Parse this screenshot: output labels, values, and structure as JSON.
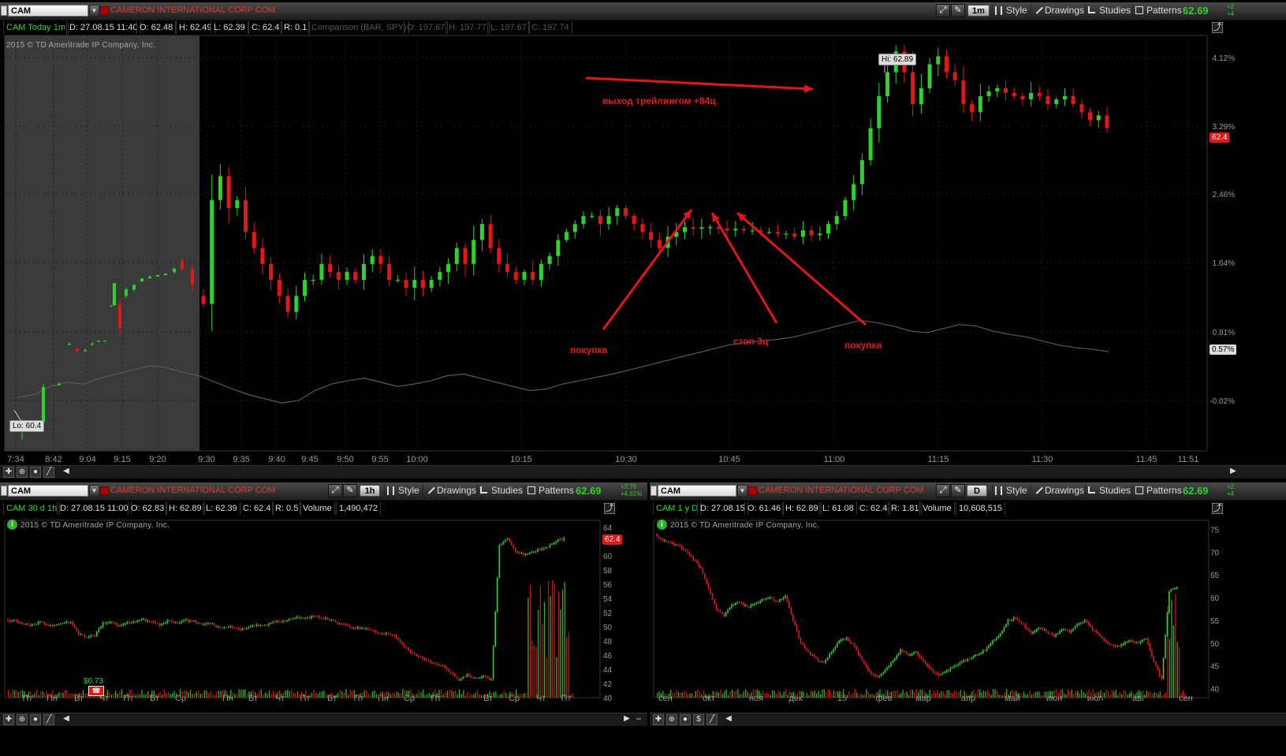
{
  "colors": {
    "up": "#2bd32b",
    "down": "#e51616",
    "compare": "#5a5a5a",
    "name": "#e03a2a",
    "grid": "#1c1c1c"
  },
  "main": {
    "symbol": "CAM",
    "company": "CAMERON INTERNATIONAL CORP COM",
    "timeframe": "1m",
    "buttons": {
      "style": "Style",
      "drawings": "Drawings",
      "studies": "Studies",
      "patterns": "Patterns"
    },
    "last": "62.69",
    "change_top": "+2",
    "change_bottom": "+4",
    "info": {
      "name": "CAM Today 1m",
      "d": "D: 27.08.15 11:40",
      "o": "O: 62.48",
      "h": "H: 62.49",
      "l": "L: 62.39",
      "c": "C: 62.4",
      "r": "R: 0.1"
    },
    "comparison": {
      "label": "Comparison (BAR, SPY)",
      "o": "O: 197.67",
      "h": "H: 197.77",
      "l": "L: 197.67",
      "c": "C: 197.74"
    },
    "copyright": "2015 © TD Ameritrade IP Company, Inc.",
    "hi_label": "Hi: 62.89",
    "lo_label": "Lo: 60.4",
    "price_tag": "62.4",
    "compare_tag": "0.57%",
    "annotations": {
      "exit": "выход трейлингом +84ц",
      "buy1": "покупка",
      "stop": "стоп 3ц",
      "buy2": "покупка"
    }
  },
  "left": {
    "symbol": "CAM",
    "company": "CAMERON INTERNATIONAL CORP COM",
    "timeframe": "1h",
    "buttons": {
      "style": "Style",
      "drawings": "Drawings",
      "studies": "Studies",
      "patterns": "Patterns"
    },
    "last": "62.69",
    "change_top": "+2.76",
    "change_bottom": "+4.61%",
    "info": {
      "name": "CAM 30 d 1h",
      "d": "D: 27.08.15 11:00",
      "o": "O: 62.83",
      "h": "H: 62.89",
      "l": "L: 62.39",
      "c": "C: 62.4",
      "r": "R: 0.5",
      "vol_label": "Volume",
      "vol": "1,490,472"
    },
    "copyright": "2015 © TD Ameritrade IP Company, Inc.",
    "price_tag": "62.4",
    "dividend": "$0.73"
  },
  "right": {
    "symbol": "CAM",
    "company": "CAMERON INTERNATIONAL CORP COM",
    "timeframe": "D",
    "buttons": {
      "style": "Style",
      "drawings": "Drawings",
      "studies": "Studies",
      "patterns": "Patterns"
    },
    "last": "62.69",
    "change_top": "+2",
    "change_bottom": "+4",
    "info": {
      "name": "CAM 1 y D",
      "d": "D: 27.08.15",
      "o": "O: 61.46",
      "h": "H: 62.89",
      "l": "L: 61.08",
      "c": "C: 62.4",
      "r": "R: 1.81",
      "vol_label": "Volume",
      "vol": "10,608,515"
    },
    "copyright": "2015 © TD Ameritrade IP Company, Inc."
  },
  "chart_data": [
    {
      "id": "main",
      "type": "candlestick",
      "title": "CAM Today 1m",
      "y_right_percent_ticks": [
        "4.12%",
        "3.29%",
        "2.46%",
        "1.64%",
        "0.81%",
        "-0.02%"
      ],
      "x_ticks": [
        "7:34",
        "8:42",
        "9:04",
        "9:15",
        "9:20",
        "9:30",
        "9:35",
        "9:40",
        "9:45",
        "9:50",
        "9:55",
        "10:00",
        "10:15",
        "10:30",
        "10:45",
        "11:00",
        "11:15",
        "11:30",
        "11:45",
        "11:51"
      ],
      "ylim": [
        60.38,
        62.98
      ],
      "high": 62.89,
      "low": 60.4,
      "last": 62.4,
      "premarket": [
        {
          "t": "7:34",
          "o": 60.52,
          "h": 60.58,
          "l": 60.45,
          "c": 60.56
        },
        {
          "t": "7:38",
          "o": 60.56,
          "h": 60.8,
          "l": 60.56,
          "c": 60.78
        },
        {
          "t": "8:42",
          "o": 60.79,
          "h": 60.81,
          "l": 60.79,
          "c": 60.8
        },
        {
          "t": "8:46",
          "o": 61.05,
          "h": 61.06,
          "l": 61.04,
          "c": 61.05
        },
        {
          "t": "8:50",
          "o": 61.02,
          "h": 61.02,
          "l": 61.0,
          "c": 61.0
        },
        {
          "t": "8:53",
          "o": 61.01,
          "h": 61.02,
          "l": 61.0,
          "c": 61.01
        },
        {
          "t": "8:57",
          "o": 61.05,
          "h": 61.06,
          "l": 61.04,
          "c": 61.05
        },
        {
          "t": "9:00",
          "o": 61.07,
          "h": 61.07,
          "l": 61.06,
          "c": 61.07
        },
        {
          "t": "9:04",
          "o": 61.07,
          "h": 61.07,
          "l": 61.07,
          "c": 61.07
        },
        {
          "t": "9:07",
          "o": 61.29,
          "h": 61.29,
          "l": 61.28,
          "c": 61.29
        },
        {
          "t": "9:11",
          "o": 61.29,
          "h": 61.43,
          "l": 61.29,
          "c": 61.43
        },
        {
          "t": "9:15",
          "o": 61.3,
          "h": 61.32,
          "l": 61.1,
          "c": 61.15
        },
        {
          "t": "9:17",
          "o": 61.35,
          "h": 61.4,
          "l": 61.34,
          "c": 61.39
        },
        {
          "t": "9:18",
          "o": 61.39,
          "h": 61.42,
          "l": 61.38,
          "c": 61.42
        },
        {
          "t": "9:19",
          "o": 61.44,
          "h": 61.46,
          "l": 61.44,
          "c": 61.46
        },
        {
          "t": "9:20",
          "o": 61.46,
          "h": 61.48,
          "l": 61.46,
          "c": 61.47
        },
        {
          "t": "9:22",
          "o": 61.47,
          "h": 61.48,
          "l": 61.47,
          "c": 61.48
        },
        {
          "t": "9:24",
          "o": 61.48,
          "h": 61.49,
          "l": 61.48,
          "c": 61.49
        },
        {
          "t": "9:26",
          "o": 61.5,
          "h": 61.53,
          "l": 61.49,
          "c": 61.52
        },
        {
          "t": "9:27",
          "o": 61.57,
          "h": 61.58,
          "l": 61.5,
          "c": 61.52
        },
        {
          "t": "9:28",
          "o": 61.52,
          "h": 61.55,
          "l": 61.38,
          "c": 61.42
        }
      ],
      "regular_close_path": [
        61.3,
        61.95,
        62.1,
        61.9,
        61.95,
        61.75,
        61.65,
        61.55,
        61.45,
        61.35,
        61.25,
        61.35,
        61.45,
        61.45,
        61.55,
        61.5,
        61.45,
        61.5,
        61.45,
        61.55,
        61.6,
        61.55,
        61.45,
        61.45,
        61.4,
        61.45,
        61.4,
        61.45,
        61.5,
        61.55,
        61.65,
        61.55,
        61.7,
        61.8,
        61.65,
        61.55,
        61.5,
        61.45,
        61.5,
        61.45,
        61.55,
        61.6,
        61.7,
        61.75,
        61.8,
        61.85,
        61.85,
        61.8,
        61.85,
        61.9,
        61.85,
        61.8,
        61.75,
        61.7,
        61.65,
        61.72,
        61.75,
        61.78,
        61.77,
        61.78,
        61.78,
        61.77,
        61.76,
        61.77,
        61.76,
        61.76,
        61.75,
        61.75,
        61.74,
        61.74,
        61.72,
        61.76,
        61.73,
        61.74,
        61.8,
        61.85,
        61.95,
        62.05,
        62.2,
        62.4,
        62.6,
        62.75,
        62.88,
        62.75,
        62.55,
        62.65,
        62.8,
        62.85,
        62.75,
        62.7,
        62.55,
        62.5,
        62.6,
        62.63,
        62.65,
        62.62,
        62.6,
        62.58,
        62.62,
        62.6,
        62.55,
        62.58,
        62.6,
        62.55,
        62.5,
        62.45,
        62.48,
        62.4
      ],
      "compare_percent_path": [
        0.02,
        0.05,
        0.15,
        0.2,
        0.18,
        0.25,
        0.3,
        0.35,
        0.4,
        0.38,
        0.32,
        0.28,
        0.2,
        0.12,
        0.05,
        0.0,
        -0.05,
        -0.02,
        0.1,
        0.18,
        0.22,
        0.25,
        0.2,
        0.15,
        0.18,
        0.22,
        0.28,
        0.3,
        0.25,
        0.2,
        0.15,
        0.1,
        0.12,
        0.18,
        0.22,
        0.26,
        0.3,
        0.35,
        0.4,
        0.45,
        0.5,
        0.55,
        0.6,
        0.65,
        0.68,
        0.7,
        0.72,
        0.75,
        0.8,
        0.85,
        0.9,
        0.95,
        0.92,
        0.88,
        0.82,
        0.8,
        0.85,
        0.9,
        0.88,
        0.82,
        0.78,
        0.75,
        0.7,
        0.65,
        0.62,
        0.6,
        0.57
      ]
    },
    {
      "id": "left",
      "type": "candlestick",
      "title": "CAM 30 d 1h",
      "y_ticks": [
        40,
        42,
        44,
        46,
        48,
        50,
        52,
        54,
        56,
        58,
        60,
        62,
        64
      ],
      "x_ticks": [
        "Пт",
        "Пн",
        "Вт",
        "Чт",
        "Пт",
        "Вт",
        "Ср",
        "Пн",
        "Вт",
        "Чт",
        "Пт",
        "Вт",
        "Пт",
        "Пн",
        "Ср",
        "Пт",
        "Вт",
        "Ср",
        "Чт",
        "Пт"
      ],
      "ylim": [
        40,
        65
      ],
      "close_path": [
        51.0,
        50.8,
        50.5,
        50.2,
        50.6,
        50.4,
        50.1,
        50.5,
        50.7,
        49.0,
        48.5,
        48.8,
        50.5,
        50.7,
        50.2,
        50.6,
        50.8,
        51.0,
        50.6,
        50.3,
        50.8,
        50.5,
        50.9,
        50.8,
        50.4,
        50.6,
        50.1,
        49.8,
        50.0,
        49.6,
        49.9,
        50.3,
        50.1,
        50.6,
        50.8,
        51.0,
        51.3,
        51.1,
        51.6,
        51.3,
        51.0,
        50.5,
        50.2,
        49.8,
        49.9,
        49.6,
        49.2,
        49.0,
        48.8,
        47.5,
        46.5,
        45.8,
        45.2,
        44.8,
        44.5,
        43.5,
        42.5,
        43.2,
        42.8,
        43.0,
        42.5,
        61.5,
        62.5,
        60.5,
        60.2,
        60.6,
        60.9,
        61.3,
        62.1,
        62.4
      ]
    },
    {
      "id": "right",
      "type": "candlestick",
      "title": "CAM 1 y D",
      "y_ticks": [
        40,
        45,
        50,
        55,
        60,
        65,
        70,
        75
      ],
      "x_ticks": [
        "сен",
        "окт",
        "ноя",
        "дек",
        "15",
        "фев",
        "мар",
        "апр",
        "май",
        "июн",
        "июл",
        "авг",
        "сен"
      ],
      "ylim": [
        38,
        77
      ],
      "close_path": [
        74.0,
        72.5,
        72.0,
        71.5,
        70.5,
        68.5,
        66.5,
        62.0,
        57.5,
        56.0,
        58.5,
        59.0,
        58.0,
        58.5,
        59.5,
        60.0,
        59.0,
        60.5,
        55.0,
        50.0,
        48.0,
        46.5,
        45.5,
        48.0,
        50.5,
        51.0,
        49.5,
        46.0,
        43.5,
        42.5,
        44.0,
        46.0,
        48.5,
        47.5,
        48.0,
        46.0,
        44.0,
        43.0,
        44.0,
        45.0,
        46.0,
        46.5,
        47.5,
        48.5,
        50.5,
        52.0,
        55.0,
        55.5,
        54.0,
        52.0,
        53.5,
        52.5,
        51.5,
        53.0,
        52.5,
        54.0,
        55.0,
        53.0,
        51.5,
        50.0,
        49.0,
        50.0,
        50.5,
        50.0,
        51.0,
        46.0,
        42.0,
        61.5,
        62.4
      ]
    }
  ]
}
